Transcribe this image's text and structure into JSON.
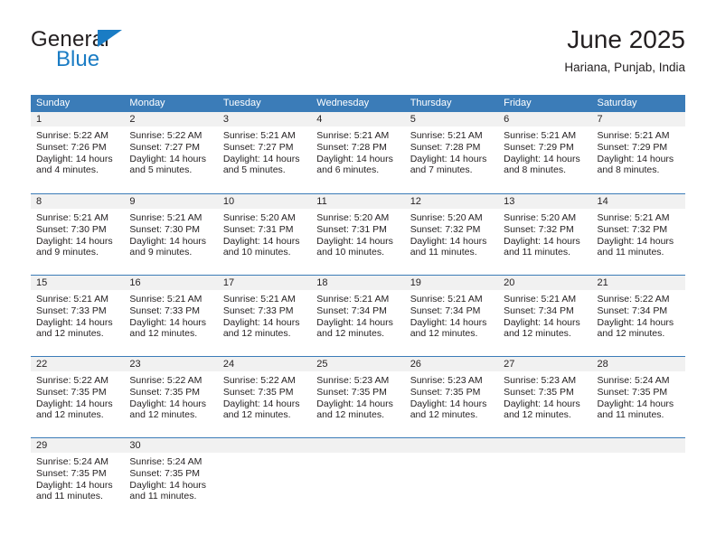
{
  "logo": {
    "word_one": "General",
    "word_two": "Blue",
    "triangle_color": "#1a7cc4",
    "text_color": "#231f20"
  },
  "header": {
    "title": "June 2025",
    "subtitle": "Hariana, Punjab, India"
  },
  "theme": {
    "header_blue": "#3b7cb8",
    "day_band_gray": "#f1f1f1",
    "text": "#231f20"
  },
  "weekdays": [
    "Sunday",
    "Monday",
    "Tuesday",
    "Wednesday",
    "Thursday",
    "Friday",
    "Saturday"
  ],
  "weeks": [
    [
      {
        "day": "1",
        "sunrise": "Sunrise: 5:22 AM",
        "sunset": "Sunset: 7:26 PM",
        "daylight_1": "Daylight: 14 hours",
        "daylight_2": "and 4 minutes."
      },
      {
        "day": "2",
        "sunrise": "Sunrise: 5:22 AM",
        "sunset": "Sunset: 7:27 PM",
        "daylight_1": "Daylight: 14 hours",
        "daylight_2": "and 5 minutes."
      },
      {
        "day": "3",
        "sunrise": "Sunrise: 5:21 AM",
        "sunset": "Sunset: 7:27 PM",
        "daylight_1": "Daylight: 14 hours",
        "daylight_2": "and 5 minutes."
      },
      {
        "day": "4",
        "sunrise": "Sunrise: 5:21 AM",
        "sunset": "Sunset: 7:28 PM",
        "daylight_1": "Daylight: 14 hours",
        "daylight_2": "and 6 minutes."
      },
      {
        "day": "5",
        "sunrise": "Sunrise: 5:21 AM",
        "sunset": "Sunset: 7:28 PM",
        "daylight_1": "Daylight: 14 hours",
        "daylight_2": "and 7 minutes."
      },
      {
        "day": "6",
        "sunrise": "Sunrise: 5:21 AM",
        "sunset": "Sunset: 7:29 PM",
        "daylight_1": "Daylight: 14 hours",
        "daylight_2": "and 8 minutes."
      },
      {
        "day": "7",
        "sunrise": "Sunrise: 5:21 AM",
        "sunset": "Sunset: 7:29 PM",
        "daylight_1": "Daylight: 14 hours",
        "daylight_2": "and 8 minutes."
      }
    ],
    [
      {
        "day": "8",
        "sunrise": "Sunrise: 5:21 AM",
        "sunset": "Sunset: 7:30 PM",
        "daylight_1": "Daylight: 14 hours",
        "daylight_2": "and 9 minutes."
      },
      {
        "day": "9",
        "sunrise": "Sunrise: 5:21 AM",
        "sunset": "Sunset: 7:30 PM",
        "daylight_1": "Daylight: 14 hours",
        "daylight_2": "and 9 minutes."
      },
      {
        "day": "10",
        "sunrise": "Sunrise: 5:20 AM",
        "sunset": "Sunset: 7:31 PM",
        "daylight_1": "Daylight: 14 hours",
        "daylight_2": "and 10 minutes."
      },
      {
        "day": "11",
        "sunrise": "Sunrise: 5:20 AM",
        "sunset": "Sunset: 7:31 PM",
        "daylight_1": "Daylight: 14 hours",
        "daylight_2": "and 10 minutes."
      },
      {
        "day": "12",
        "sunrise": "Sunrise: 5:20 AM",
        "sunset": "Sunset: 7:32 PM",
        "daylight_1": "Daylight: 14 hours",
        "daylight_2": "and 11 minutes."
      },
      {
        "day": "13",
        "sunrise": "Sunrise: 5:20 AM",
        "sunset": "Sunset: 7:32 PM",
        "daylight_1": "Daylight: 14 hours",
        "daylight_2": "and 11 minutes."
      },
      {
        "day": "14",
        "sunrise": "Sunrise: 5:21 AM",
        "sunset": "Sunset: 7:32 PM",
        "daylight_1": "Daylight: 14 hours",
        "daylight_2": "and 11 minutes."
      }
    ],
    [
      {
        "day": "15",
        "sunrise": "Sunrise: 5:21 AM",
        "sunset": "Sunset: 7:33 PM",
        "daylight_1": "Daylight: 14 hours",
        "daylight_2": "and 12 minutes."
      },
      {
        "day": "16",
        "sunrise": "Sunrise: 5:21 AM",
        "sunset": "Sunset: 7:33 PM",
        "daylight_1": "Daylight: 14 hours",
        "daylight_2": "and 12 minutes."
      },
      {
        "day": "17",
        "sunrise": "Sunrise: 5:21 AM",
        "sunset": "Sunset: 7:33 PM",
        "daylight_1": "Daylight: 14 hours",
        "daylight_2": "and 12 minutes."
      },
      {
        "day": "18",
        "sunrise": "Sunrise: 5:21 AM",
        "sunset": "Sunset: 7:34 PM",
        "daylight_1": "Daylight: 14 hours",
        "daylight_2": "and 12 minutes."
      },
      {
        "day": "19",
        "sunrise": "Sunrise: 5:21 AM",
        "sunset": "Sunset: 7:34 PM",
        "daylight_1": "Daylight: 14 hours",
        "daylight_2": "and 12 minutes."
      },
      {
        "day": "20",
        "sunrise": "Sunrise: 5:21 AM",
        "sunset": "Sunset: 7:34 PM",
        "daylight_1": "Daylight: 14 hours",
        "daylight_2": "and 12 minutes."
      },
      {
        "day": "21",
        "sunrise": "Sunrise: 5:22 AM",
        "sunset": "Sunset: 7:34 PM",
        "daylight_1": "Daylight: 14 hours",
        "daylight_2": "and 12 minutes."
      }
    ],
    [
      {
        "day": "22",
        "sunrise": "Sunrise: 5:22 AM",
        "sunset": "Sunset: 7:35 PM",
        "daylight_1": "Daylight: 14 hours",
        "daylight_2": "and 12 minutes."
      },
      {
        "day": "23",
        "sunrise": "Sunrise: 5:22 AM",
        "sunset": "Sunset: 7:35 PM",
        "daylight_1": "Daylight: 14 hours",
        "daylight_2": "and 12 minutes."
      },
      {
        "day": "24",
        "sunrise": "Sunrise: 5:22 AM",
        "sunset": "Sunset: 7:35 PM",
        "daylight_1": "Daylight: 14 hours",
        "daylight_2": "and 12 minutes."
      },
      {
        "day": "25",
        "sunrise": "Sunrise: 5:23 AM",
        "sunset": "Sunset: 7:35 PM",
        "daylight_1": "Daylight: 14 hours",
        "daylight_2": "and 12 minutes."
      },
      {
        "day": "26",
        "sunrise": "Sunrise: 5:23 AM",
        "sunset": "Sunset: 7:35 PM",
        "daylight_1": "Daylight: 14 hours",
        "daylight_2": "and 12 minutes."
      },
      {
        "day": "27",
        "sunrise": "Sunrise: 5:23 AM",
        "sunset": "Sunset: 7:35 PM",
        "daylight_1": "Daylight: 14 hours",
        "daylight_2": "and 12 minutes."
      },
      {
        "day": "28",
        "sunrise": "Sunrise: 5:24 AM",
        "sunset": "Sunset: 7:35 PM",
        "daylight_1": "Daylight: 14 hours",
        "daylight_2": "and 11 minutes."
      }
    ],
    [
      {
        "day": "29",
        "sunrise": "Sunrise: 5:24 AM",
        "sunset": "Sunset: 7:35 PM",
        "daylight_1": "Daylight: 14 hours",
        "daylight_2": "and 11 minutes."
      },
      {
        "day": "30",
        "sunrise": "Sunrise: 5:24 AM",
        "sunset": "Sunset: 7:35 PM",
        "daylight_1": "Daylight: 14 hours",
        "daylight_2": "and 11 minutes."
      },
      {
        "day": "",
        "sunrise": "",
        "sunset": "",
        "daylight_1": "",
        "daylight_2": ""
      },
      {
        "day": "",
        "sunrise": "",
        "sunset": "",
        "daylight_1": "",
        "daylight_2": ""
      },
      {
        "day": "",
        "sunrise": "",
        "sunset": "",
        "daylight_1": "",
        "daylight_2": ""
      },
      {
        "day": "",
        "sunrise": "",
        "sunset": "",
        "daylight_1": "",
        "daylight_2": ""
      },
      {
        "day": "",
        "sunrise": "",
        "sunset": "",
        "daylight_1": "",
        "daylight_2": ""
      }
    ]
  ]
}
